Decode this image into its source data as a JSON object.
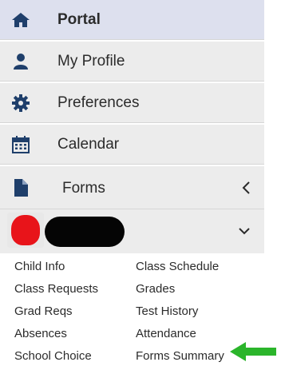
{
  "nav": {
    "portal": {
      "label": "Portal",
      "icon": "home-icon"
    },
    "profile": {
      "label": "My Profile",
      "icon": "user-icon"
    },
    "preferences": {
      "label": "Preferences",
      "icon": "gear-icon"
    },
    "calendar": {
      "label": "Calendar",
      "icon": "calendar-icon"
    },
    "forms": {
      "label": "Forms",
      "icon": "document-icon"
    }
  },
  "student": {
    "caret": "chevron-down-icon"
  },
  "links": {
    "child_info": "Child Info",
    "class_schedule": "Class Schedule",
    "class_requests": "Class Requests",
    "grades": "Grades",
    "grad_reqs": "Grad Reqs",
    "test_history": "Test History",
    "absences": "Absences",
    "attendance": "Attendance",
    "school_choice": "School Choice",
    "forms_summary": "Forms Summary"
  },
  "colors": {
    "icon": "#1f3f6b",
    "active_bg": "#dde0ee",
    "item_bg": "#ececec",
    "arrow": "#2bb52b"
  }
}
